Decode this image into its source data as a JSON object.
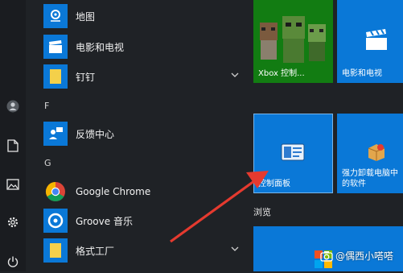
{
  "colors": {
    "background": "#1f2226",
    "tile_blue": "#0a78d7",
    "tile_green": "#127c12",
    "folder_yellow": "#f4d04a",
    "arrow_red": "#e53a2f"
  },
  "rail": {
    "items": [
      {
        "icon": "user-avatar-icon"
      },
      {
        "icon": "document-icon"
      },
      {
        "icon": "pictures-icon"
      },
      {
        "icon": "settings-gear-icon"
      },
      {
        "icon": "power-icon"
      }
    ]
  },
  "app_list": {
    "rows": [
      {
        "label": "地图",
        "icon": "map-icon"
      },
      {
        "label": "电影和电视",
        "icon": "film-clapper-icon"
      },
      {
        "label": "钉钉",
        "icon": "folder-icon"
      },
      {
        "label": "反馈中心",
        "icon": "feedback-hub-icon"
      },
      {
        "label": "Google Chrome",
        "icon": "chrome-icon"
      },
      {
        "label": "Groove 音乐",
        "icon": "groove-music-icon"
      },
      {
        "label": "格式工厂",
        "icon": "folder-icon"
      }
    ],
    "letters": [
      "F",
      "G"
    ]
  },
  "tiles": {
    "xbox": {
      "label": "Xbox 控制..."
    },
    "movies": {
      "label": "电影和电视"
    },
    "control_panel": {
      "label": "控制面板"
    },
    "uninstaller": {
      "label": "强力卸载电脑中的软件"
    },
    "group_browse": "浏览"
  },
  "watermark": "@偶西小嗒嗒"
}
